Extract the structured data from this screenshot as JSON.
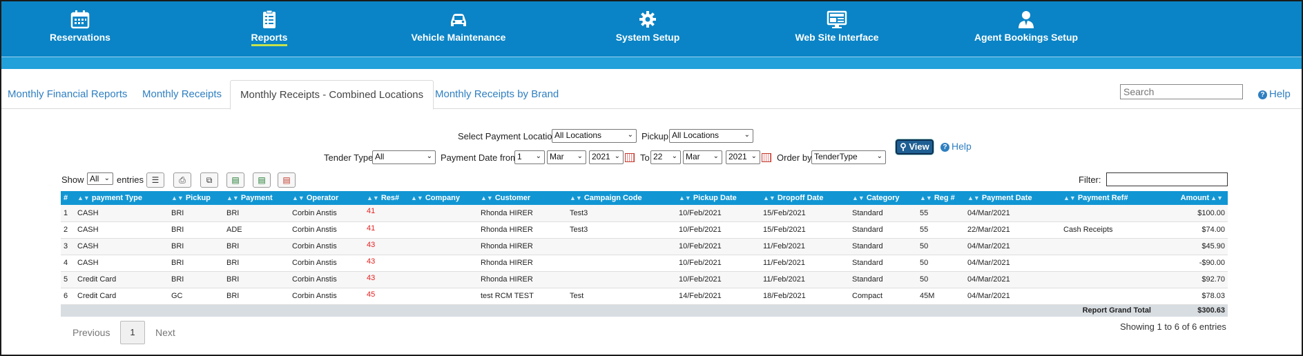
{
  "nav": {
    "items": [
      {
        "label": "Reservations",
        "icon": "calendar-icon"
      },
      {
        "label": "Reports",
        "icon": "clipboard-icon",
        "active": true
      },
      {
        "label": "Vehicle Maintenance",
        "icon": "car-icon"
      },
      {
        "label": "System Setup",
        "icon": "gear-icon"
      },
      {
        "label": "Web Site Interface",
        "icon": "monitor-icon"
      },
      {
        "label": "Agent Bookings Setup",
        "icon": "agent-icon"
      }
    ],
    "colors": {
      "bar": "#0a84c6",
      "active_underline": "#c6e34b"
    }
  },
  "tabs": [
    {
      "label": "Monthly Financial Reports"
    },
    {
      "label": "Monthly Receipts"
    },
    {
      "label": "Monthly Receipts - Combined Locations",
      "active": true
    },
    {
      "label": "Monthly Receipts by Brand"
    }
  ],
  "search": {
    "placeholder": "Search"
  },
  "help_label": "Help",
  "form": {
    "payment_location_label": "Select Payment Location",
    "payment_location_value": "All Locations",
    "pickup_label": "Pickup",
    "pickup_value": "All Locations",
    "tender_type_label": "Tender Type",
    "tender_type_value": "All",
    "date_from_label": "Payment Date from",
    "from_day": "1",
    "from_month": "Mar",
    "from_year": "2021",
    "to_label": "To",
    "to_day": "22",
    "to_month": "Mar",
    "to_year": "2021",
    "order_by_label": "Order by",
    "order_by_value": "TenderType",
    "view_label": "View",
    "help_label": "Help"
  },
  "table_tools": {
    "show_label": "Show",
    "entries_value": "All",
    "entries_label": "entries",
    "filter_label": "Filter:"
  },
  "table": {
    "headers": [
      "#",
      "payment Type",
      "Pickup",
      "Payment",
      "Operator",
      "Res#",
      "Company",
      "Customer",
      "Campaign Code",
      "Pickup Date",
      "Dropoff Date",
      "Category",
      "Reg #",
      "Payment Date",
      "Payment Ref#",
      "Amount"
    ],
    "rows": [
      [
        "1",
        "CASH",
        "BRI",
        "BRI",
        "Corbin Anstis",
        "41",
        "",
        "Rhonda HIRER",
        "Test3",
        "10/Feb/2021",
        "15/Feb/2021",
        "Standard",
        "55",
        "04/Mar/2021",
        "",
        "$100.00"
      ],
      [
        "2",
        "CASH",
        "BRI",
        "ADE",
        "Corbin Anstis",
        "41",
        "",
        "Rhonda HIRER",
        "Test3",
        "10/Feb/2021",
        "15/Feb/2021",
        "Standard",
        "55",
        "22/Mar/2021",
        "Cash Receipts",
        "$74.00"
      ],
      [
        "3",
        "CASH",
        "BRI",
        "BRI",
        "Corbin Anstis",
        "43",
        "",
        "Rhonda HIRER",
        "",
        "10/Feb/2021",
        "11/Feb/2021",
        "Standard",
        "50",
        "04/Mar/2021",
        "",
        "$45.90"
      ],
      [
        "4",
        "CASH",
        "BRI",
        "BRI",
        "Corbin Anstis",
        "43",
        "",
        "Rhonda HIRER",
        "",
        "10/Feb/2021",
        "11/Feb/2021",
        "Standard",
        "50",
        "04/Mar/2021",
        "",
        "-$90.00"
      ],
      [
        "5",
        "Credit Card",
        "BRI",
        "BRI",
        "Corbin Anstis",
        "43",
        "",
        "Rhonda HIRER",
        "",
        "10/Feb/2021",
        "11/Feb/2021",
        "Standard",
        "50",
        "04/Mar/2021",
        "",
        "$92.70"
      ],
      [
        "6",
        "Credit Card",
        "GC",
        "BRI",
        "Corbin Anstis",
        "45",
        "",
        "test RCM TEST",
        "Test",
        "14/Feb/2021",
        "18/Feb/2021",
        "Compact",
        "45M",
        "04/Mar/2021",
        "",
        "$78.03"
      ]
    ],
    "total_label": "Report Grand Total",
    "total_value": "$300.63"
  },
  "pagination": {
    "previous": "Previous",
    "current": "1",
    "next": "Next",
    "summary": "Showing 1 to 6 of 6 entries"
  }
}
